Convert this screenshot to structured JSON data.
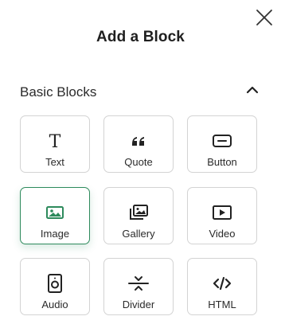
{
  "dialog": {
    "title": "Add a Block",
    "close_icon": "close-icon"
  },
  "section": {
    "title": "Basic Blocks",
    "toggle_icon": "chevron-up-icon",
    "expanded": true
  },
  "blocks": [
    {
      "label": "Text",
      "icon": "text-icon",
      "selected": false
    },
    {
      "label": "Quote",
      "icon": "quote-icon",
      "selected": false
    },
    {
      "label": "Button",
      "icon": "button-icon",
      "selected": false
    },
    {
      "label": "Image",
      "icon": "image-icon",
      "selected": true
    },
    {
      "label": "Gallery",
      "icon": "gallery-icon",
      "selected": false
    },
    {
      "label": "Video",
      "icon": "video-icon",
      "selected": false
    },
    {
      "label": "Audio",
      "icon": "audio-icon",
      "selected": false
    },
    {
      "label": "Divider",
      "icon": "divider-icon",
      "selected": false
    },
    {
      "label": "HTML",
      "icon": "html-icon",
      "selected": false
    }
  ],
  "colors": {
    "accent": "#2d8a5c",
    "text": "#1f1f1f",
    "border": "#d3d3d3"
  }
}
